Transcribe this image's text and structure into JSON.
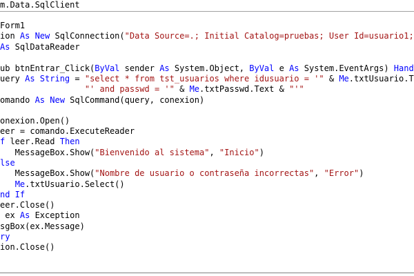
{
  "editor": {
    "colors": {
      "keyword": "#0000ff",
      "string": "#a31515",
      "text": "#000000",
      "background": "#ffffff"
    },
    "lines": [
      [
        {
          "t": "m.Data.SqlClient",
          "c": "n"
        }
      ],
      [
        {
          "t": "Form1",
          "c": "n"
        }
      ],
      [
        {
          "t": "ion ",
          "c": "n"
        },
        {
          "t": "As New",
          "c": "k"
        },
        {
          "t": " SqlConnection(",
          "c": "n"
        },
        {
          "t": "\"Data Source=.; Initial Catalog=pruebas; User Id=usuario1;",
          "c": "s"
        }
      ],
      [
        {
          "t": "As",
          "c": "k"
        },
        {
          "t": " SqlDataReader",
          "c": "n"
        }
      ],
      [
        {
          "t": "ub btnEntrar_Click(",
          "c": "n"
        },
        {
          "t": "ByVal",
          "c": "k"
        },
        {
          "t": " sender ",
          "c": "n"
        },
        {
          "t": "As",
          "c": "k"
        },
        {
          "t": " System.Object, ",
          "c": "n"
        },
        {
          "t": "ByVal",
          "c": "k"
        },
        {
          "t": " e ",
          "c": "n"
        },
        {
          "t": "As",
          "c": "k"
        },
        {
          "t": " System.EventArgs) ",
          "c": "n"
        },
        {
          "t": "Handl",
          "c": "k"
        }
      ],
      [
        {
          "t": "uery ",
          "c": "n"
        },
        {
          "t": "As String",
          "c": "k"
        },
        {
          "t": " = ",
          "c": "n"
        },
        {
          "t": "\"select * from tst_usuarios where idusuario = '\"",
          "c": "s"
        },
        {
          "t": " & ",
          "c": "n"
        },
        {
          "t": "Me",
          "c": "k"
        },
        {
          "t": ".txtUsuario.Te",
          "c": "n"
        }
      ],
      [
        {
          "t": "                 ",
          "c": "n"
        },
        {
          "t": "\"' and passwd = '\"",
          "c": "s"
        },
        {
          "t": " & ",
          "c": "n"
        },
        {
          "t": "Me",
          "c": "k"
        },
        {
          "t": ".txtPasswd.Text & ",
          "c": "n"
        },
        {
          "t": "\"'\"",
          "c": "s"
        }
      ],
      [
        {
          "t": "omando ",
          "c": "n"
        },
        {
          "t": "As New",
          "c": "k"
        },
        {
          "t": " SqlCommand(query, conexion)",
          "c": "n"
        }
      ],
      [
        {
          "t": "onexion.Open()",
          "c": "n"
        }
      ],
      [
        {
          "t": "eer = comando.ExecuteReader",
          "c": "n"
        }
      ],
      [
        {
          "t": "f",
          "c": "k"
        },
        {
          "t": " leer.Read ",
          "c": "n"
        },
        {
          "t": "Then",
          "c": "k"
        }
      ],
      [
        {
          "t": "   MessageBox.Show(",
          "c": "n"
        },
        {
          "t": "\"Bienvenido al sistema\"",
          "c": "s"
        },
        {
          "t": ", ",
          "c": "n"
        },
        {
          "t": "\"Inicio\"",
          "c": "s"
        },
        {
          "t": ")",
          "c": "n"
        }
      ],
      [
        {
          "t": "lse",
          "c": "k"
        }
      ],
      [
        {
          "t": "   MessageBox.Show(",
          "c": "n"
        },
        {
          "t": "\"Nombre de usuario o contraseña incorrectas\"",
          "c": "s"
        },
        {
          "t": ", ",
          "c": "n"
        },
        {
          "t": "\"Error\"",
          "c": "s"
        },
        {
          "t": ")",
          "c": "n"
        }
      ],
      [
        {
          "t": "   ",
          "c": "n"
        },
        {
          "t": "Me",
          "c": "k"
        },
        {
          "t": ".txtUsuario.Select()",
          "c": "n"
        }
      ],
      [
        {
          "t": "nd If",
          "c": "k"
        }
      ],
      [
        {
          "t": "eer.Close()",
          "c": "n"
        }
      ],
      [
        {
          "t": " ex ",
          "c": "n"
        },
        {
          "t": "As",
          "c": "k"
        },
        {
          "t": " Exception",
          "c": "n"
        }
      ],
      [
        {
          "t": "sgBox(ex.Message)",
          "c": "n"
        }
      ],
      [
        {
          "t": "ry",
          "c": "k"
        }
      ],
      [
        {
          "t": "ion.Close()",
          "c": "n"
        }
      ]
    ]
  }
}
